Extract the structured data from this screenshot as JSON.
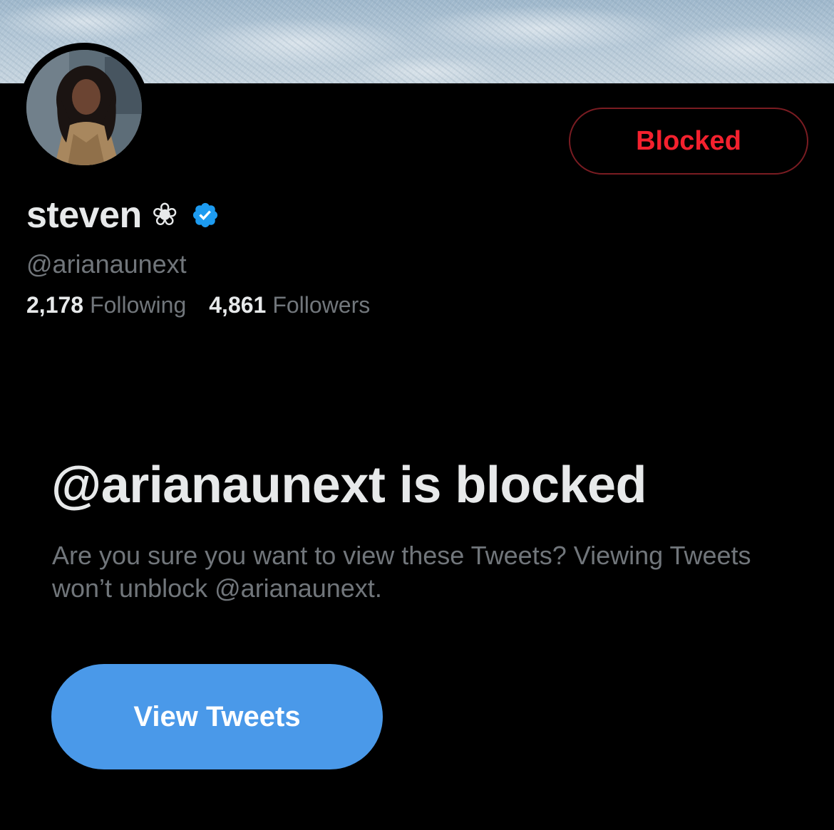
{
  "profile": {
    "display_name": "steven",
    "name_emoji": "❀",
    "verified": true,
    "handle": "@arianaunext",
    "following_count": "2,178",
    "following_label": "Following",
    "followers_count": "4,861",
    "followers_label": "Followers",
    "blocked_button_label": "Blocked"
  },
  "blocked_notice": {
    "title": "@arianaunext is blocked",
    "description": "Are you sure you want to view these Tweets? Viewing Tweets won’t unblock @arianaunext.",
    "view_button_label": "View Tweets"
  },
  "colors": {
    "background": "#000000",
    "blocked_red": "#f4212e",
    "accent_blue": "#4a99e9",
    "verified_blue": "#1d9bf0",
    "secondary_text": "#71767b"
  },
  "icons": {
    "verified": "verified-badge-icon",
    "avatar": "profile-photo"
  }
}
